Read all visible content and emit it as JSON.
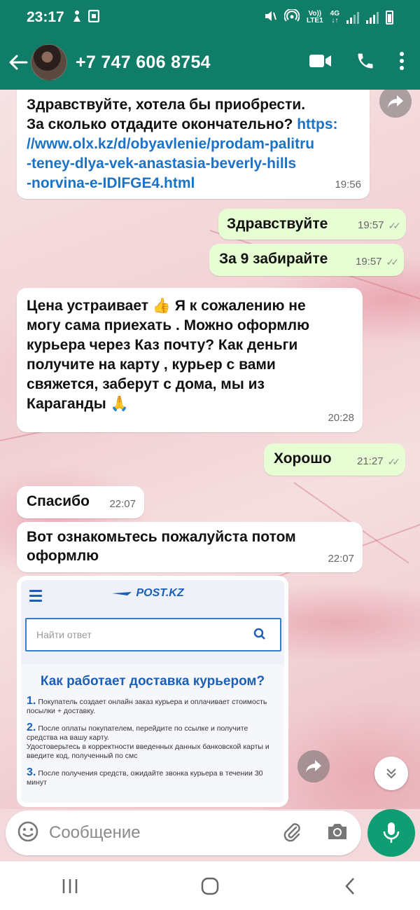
{
  "status_bar": {
    "time": "23:17",
    "network_top": "Vo))",
    "network_bottom": "LTE1",
    "network_gen": "4G"
  },
  "header": {
    "contact": "+7 747 606 8754",
    "icons": [
      "back-arrow-icon",
      "video-call-icon",
      "phone-call-icon",
      "more-options-icon"
    ]
  },
  "messages": [
    {
      "direction": "in",
      "text": "Здравствуйте, хотела бы приобрести.",
      "text2": "За сколько отдадите окончательно?",
      "link": "https://www.olx.kz/d/obyavlenie/prodam-palitru-teney-dlya-vek-anastasia-beverly-hills-norvina-e-IDlFGE4.html",
      "link_line1": "https:",
      "link_line2": "//www.olx.kz/d/obyavlenie/prodam-palitru",
      "link_line3": "-teney-dlya-vek-anastasia-beverly-hills",
      "link_line4": "-norvina-e-IDlFGE4.html",
      "time": "19:56"
    },
    {
      "direction": "out",
      "text": "Здравствуйте",
      "time": "19:57"
    },
    {
      "direction": "out",
      "text": "За 9 забирайте",
      "time": "19:57"
    },
    {
      "direction": "in",
      "line1": "Цена устраивает 👍 Я к сожалению не",
      "line2": "могу сама приехать . Можно оформлю",
      "line3": "курьера через Каз  почту? Как деньги",
      "line4": "получите на карту , курьер с вами",
      "line5": "свяжется, заберут с дома, мы из",
      "line6": "Караганды 🙏",
      "time": "20:28"
    },
    {
      "direction": "out",
      "text": "Хорошо",
      "time": "21:27"
    },
    {
      "direction": "in",
      "text": "Спасибо",
      "time": "22:07"
    },
    {
      "direction": "in",
      "line1": "Вот ознакомьтесь пожалуйста потом",
      "line2": "оформлю",
      "time": "22:07"
    }
  ],
  "image_message": {
    "logo": "POST.KZ",
    "search_placeholder": "Найти ответ",
    "title": "Как работает доставка курьером?",
    "steps": [
      {
        "num": "1.",
        "text": "Покупатель создает онлайн заказ курьера и оплачивает стоимость посылки + доставку."
      },
      {
        "num": "2.",
        "text": "После оплаты покупателем, перейдите по ссылке и получите средства на вашу карту.",
        "extra": "Удостоверьтесь в корректности введенных данных банковской карты и введите код, полученный по смс"
      },
      {
        "num": "3.",
        "text": "После получения средств, ожидайте звонка курьера в течении 30 минут"
      }
    ]
  },
  "composer": {
    "placeholder": "Сообщение"
  },
  "colors": {
    "header": "#0f7d68",
    "outgoing_bubble": "#e7fdd3",
    "incoming_bubble": "#ffffff",
    "link": "#1a73c9",
    "mic_button": "#0f9d73"
  }
}
